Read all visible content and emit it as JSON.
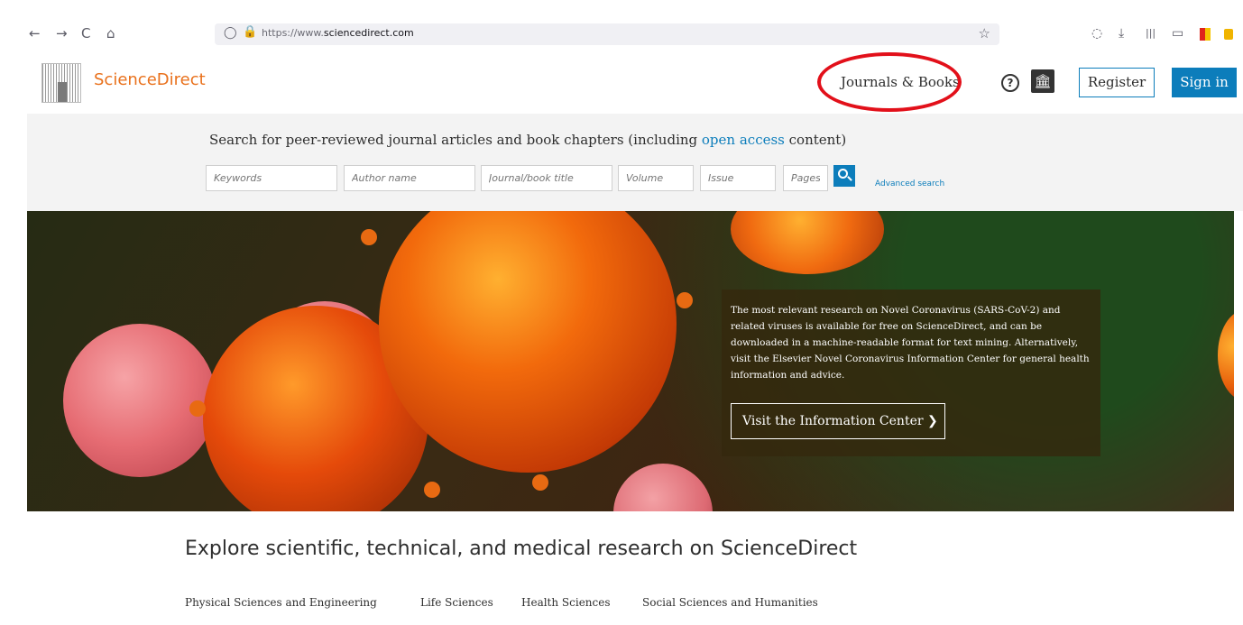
{
  "browser": {
    "back_glyph": "←",
    "forward_glyph": "→",
    "reload_glyph": "C",
    "home_glyph": "⌂",
    "shield_glyph": "◯",
    "lock_glyph": "🔒",
    "url_prefix": "https://www.",
    "url_domain": "sciencedirect.com",
    "star_glyph": "☆",
    "pocket_glyph": "◌",
    "download_glyph": "⤓",
    "library_glyph": "|||",
    "sidebar_glyph": "▭",
    "toolbar_icons": [
      "pocket-icon",
      "download-icon",
      "library-icon",
      "sidebar-icon",
      "extension-icon",
      "extension-cart-icon"
    ]
  },
  "header": {
    "site_name": "ScienceDirect",
    "journals_books": "Journals & Books",
    "help_glyph": "?",
    "institution_glyph": "🏛",
    "register": "Register",
    "sign_in": "Sign in",
    "accent": "#e9711c",
    "brand_blue": "#0c7dbb"
  },
  "search": {
    "tagline_before": "Search for peer-reviewed journal articles and book chapters (including ",
    "tagline_link": "open access",
    "tagline_after": " content)",
    "keywords_placeholder": "Keywords",
    "author_placeholder": "Author name",
    "journal_placeholder": "Journal/book title",
    "volume_placeholder": "Volume",
    "issue_placeholder": "Issue",
    "pages_placeholder": "Pages",
    "advanced": "Advanced search"
  },
  "hero": {
    "text": "The most relevant research on Novel Coronavirus (SARS-CoV-2) and related viruses is available for free on ScienceDirect, and can be downloaded in a machine-readable format for text mining. Alternatively, visit the Elsevier Novel Coronavirus Information Center for general health information and advice.",
    "button": "Visit the Information Center",
    "button_chevron": "❯"
  },
  "explore": {
    "title": "Explore scientific, technical, and medical research on ScienceDirect",
    "subjects": [
      "Physical Sciences and Engineering",
      "Life Sciences",
      "Health Sciences",
      "Social Sciences and Humanities"
    ]
  }
}
